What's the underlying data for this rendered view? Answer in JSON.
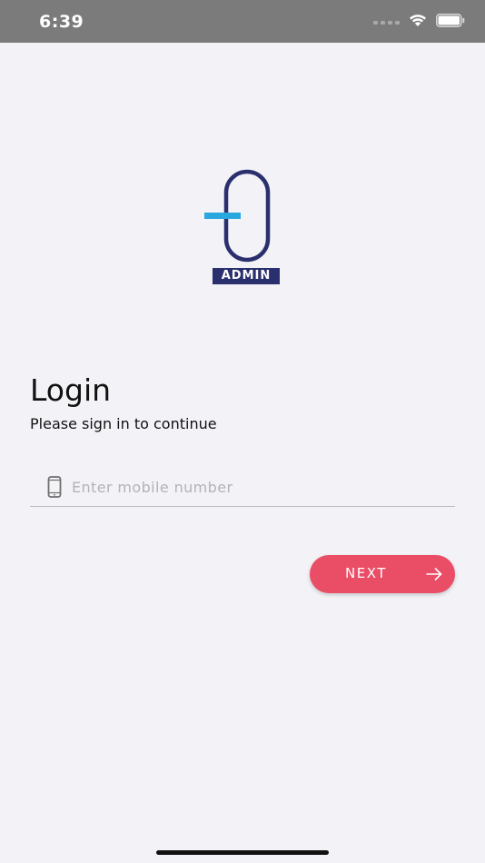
{
  "status_bar": {
    "time": "6:39",
    "icons": [
      "signal-icon",
      "wifi-icon",
      "battery-icon"
    ]
  },
  "logo": {
    "label": "ADMIN",
    "colors": {
      "navy": "#2a2f6d",
      "accent": "#29a8e0"
    }
  },
  "login": {
    "title": "Login",
    "subtitle": "Please sign in to continue",
    "phone_field": {
      "icon": "mobile-phone-icon",
      "value": "",
      "placeholder": "Enter mobile number"
    },
    "next_button": {
      "label": "NEXT",
      "icon": "arrow-right-icon",
      "color": "#ea4d66"
    }
  },
  "colors": {
    "background": "#f3f2f7",
    "status_bar": "#7b7b7b"
  }
}
